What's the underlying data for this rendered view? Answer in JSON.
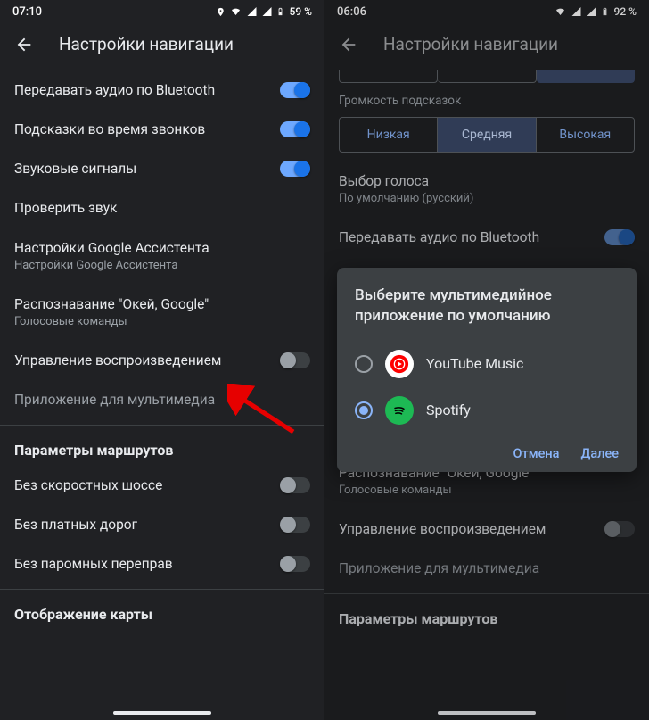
{
  "left": {
    "status": {
      "time": "07:10",
      "battery": "59 %"
    },
    "title": "Настройки навигации",
    "rows": {
      "bluetooth": "Передавать аудио по Bluetooth",
      "calls": "Подсказки во время звонков",
      "sounds": "Звуковые сигналы",
      "test_sound": "Проверить звук",
      "assistant": {
        "primary": "Настройки Google Ассистента",
        "secondary": "Настройки Google Ассистента"
      },
      "okgoogle": {
        "primary": "Распознавание \"Окей, Google\"",
        "secondary": "Голосовые команды"
      },
      "playback": "Управление воспроизведением",
      "media_app": "Приложение для мультимедиа"
    },
    "section_routes": "Параметры маршрутов",
    "route_rows": {
      "highways": "Без скоростных шоссе",
      "tolls": "Без платных дорог",
      "ferries": "Без паромных переправ"
    },
    "section_map": "Отображение карты"
  },
  "right": {
    "status": {
      "time": "06:06",
      "battery": "92 %"
    },
    "title": "Настройки навигации",
    "volume_label": "Громкость подсказок",
    "volume_opts": {
      "low": "Низкая",
      "mid": "Средняя",
      "high": "Высокая"
    },
    "voice": {
      "primary": "Выбор голоса",
      "secondary": "По умолчанию (русский)"
    },
    "bluetooth": "Передавать аудио по Bluetooth",
    "okgoogle": {
      "primary": "Распознавание \"Окей, Google\"",
      "secondary": "Голосовые команды"
    },
    "playback": "Управление воспроизведением",
    "media_app": "Приложение для мультимедиа",
    "section_routes": "Параметры маршрутов",
    "dialog": {
      "title": "Выберите мультимедийное приложение по умолчанию",
      "opt1": "YouTube Music",
      "opt2": "Spotify",
      "cancel": "Отмена",
      "next": "Далее"
    }
  }
}
